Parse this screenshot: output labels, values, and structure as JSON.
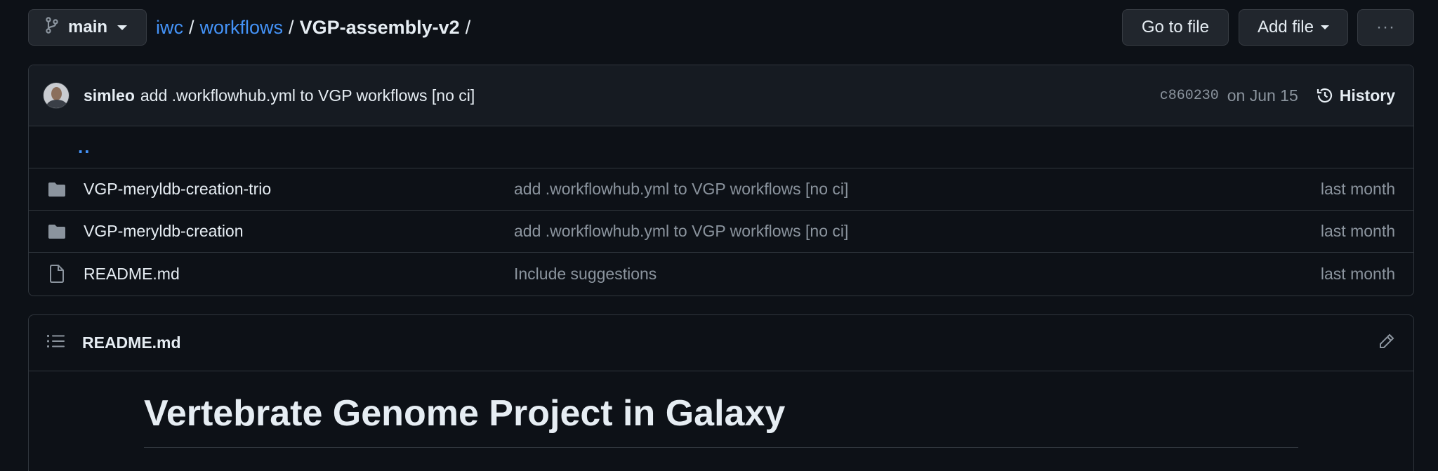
{
  "topbar": {
    "branch": "main",
    "breadcrumb": {
      "repo": "iwc",
      "folder": "workflows",
      "current": "VGP-assembly-v2",
      "separator": "/"
    },
    "goto_file": "Go to file",
    "add_file": "Add file",
    "more": "···"
  },
  "commit": {
    "author": "simleo",
    "message": "add .workflowhub.yml to VGP workflows [no ci]",
    "sha": "c860230",
    "date": "on Jun 15",
    "history_label": "History"
  },
  "parent_link": "..",
  "files": [
    {
      "type": "folder",
      "name": "VGP-meryldb-creation-trio",
      "message": "add .workflowhub.yml to VGP workflows [no ci]",
      "date": "last month"
    },
    {
      "type": "folder",
      "name": "VGP-meryldb-creation",
      "message": "add .workflowhub.yml to VGP workflows [no ci]",
      "date": "last month"
    },
    {
      "type": "file",
      "name": "README.md",
      "message": "Include suggestions",
      "date": "last month"
    }
  ],
  "readme": {
    "filename": "README.md",
    "heading": "Vertebrate Genome Project in Galaxy"
  },
  "colors": {
    "background": "#0d1117",
    "link": "#4493f8",
    "muted": "#8b949e",
    "border": "#30363d"
  }
}
